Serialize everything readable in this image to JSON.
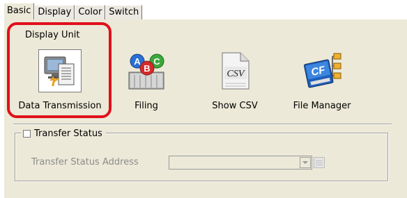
{
  "tabs": [
    {
      "label": "Basic",
      "active": true
    },
    {
      "label": "Display",
      "active": false
    },
    {
      "label": "Color",
      "active": false
    },
    {
      "label": "Switch",
      "active": false
    }
  ],
  "display_unit": {
    "title": "Display Unit",
    "highlight_color": "#e0101a",
    "tools": [
      {
        "label": "Data Transmission",
        "icon": "data-transmission-icon",
        "selected": true
      },
      {
        "label": "Filing",
        "icon": "filing-abc-icon",
        "selected": false
      },
      {
        "label": "Show CSV",
        "icon": "csv-file-icon",
        "selected": false
      },
      {
        "label": "File Manager",
        "icon": "cf-card-folder-icon",
        "selected": false
      }
    ]
  },
  "transfer_status": {
    "checkbox_label": "Transfer Status",
    "checked": false,
    "address_label": "Transfer Status Address",
    "address_value": ""
  },
  "colors": {
    "panel_bg": "#ece9d8",
    "disabled_text": "#8c8c8c"
  }
}
